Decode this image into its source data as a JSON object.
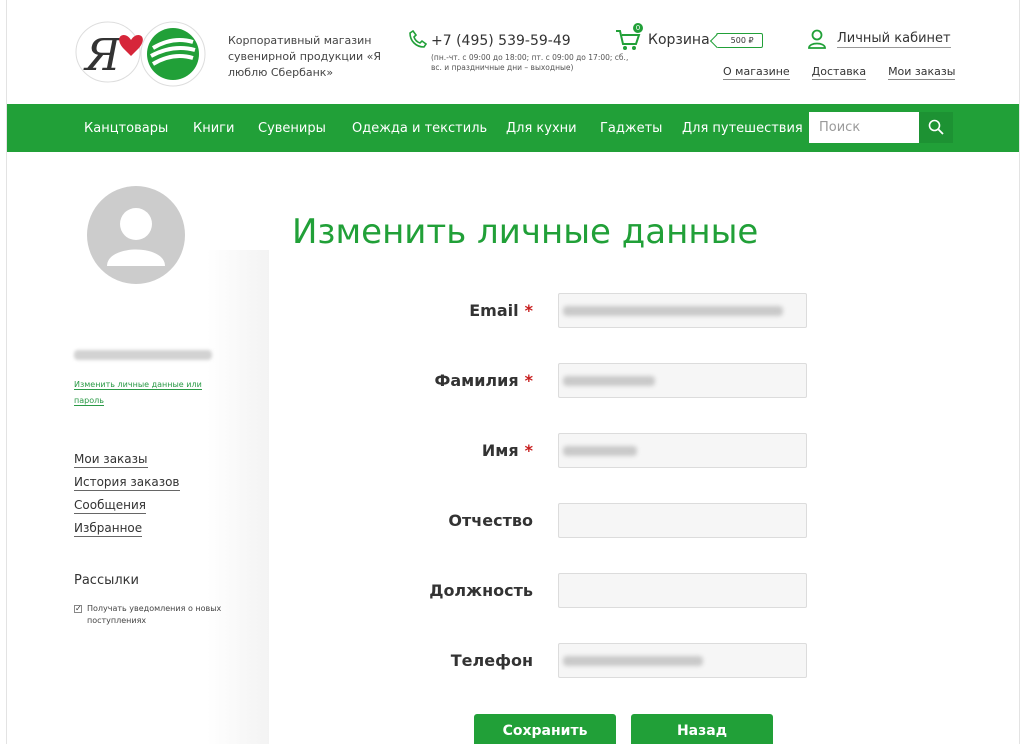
{
  "header": {
    "logo_text": "Я",
    "tagline": "Корпоративный магазин сувенирной продукции «Я люблю Сбербанк»",
    "phone": "+7 (495) 539-59-49",
    "hours": "(пн.-чт. с 09:00 до 18:00; пт. с 09:00 до 17:00; сб., вс. и праздничные дни – выходные)",
    "cart_label": "Корзина",
    "cart_count": "0",
    "cart_price": "500 ₽",
    "account_label": "Личный кабинет",
    "top_links": [
      "О магазине",
      "Доставка",
      "Мои заказы"
    ]
  },
  "nav": {
    "items": [
      "Канцтовары",
      "Книги",
      "Сувениры",
      "Одежда и текстиль",
      "Для кухни",
      "Гаджеты",
      "Для путешествия"
    ],
    "search_placeholder": "Поиск"
  },
  "sidebar": {
    "edit_link": "Изменить личные данные или пароль",
    "menu": [
      "Мои заказы",
      "История заказов",
      "Сообщения",
      "Избранное"
    ],
    "newsletter_title": "Рассылки",
    "newsletter_option": "Получать уведомления о новых поступлениях",
    "newsletter_checked": true
  },
  "form": {
    "title": "Изменить личные данные",
    "fields": [
      {
        "label": "Email",
        "required": "*"
      },
      {
        "label": "Фамилия",
        "required": "*"
      },
      {
        "label": "Имя",
        "required": "*"
      },
      {
        "label": "Отчество",
        "required": ""
      },
      {
        "label": "Должность",
        "required": ""
      },
      {
        "label": "Телефон",
        "required": ""
      }
    ],
    "save_button": "Сохранить",
    "back_button": "Назад"
  },
  "colors": {
    "brand_green": "#21a038",
    "required_red": "#c71d1d"
  }
}
